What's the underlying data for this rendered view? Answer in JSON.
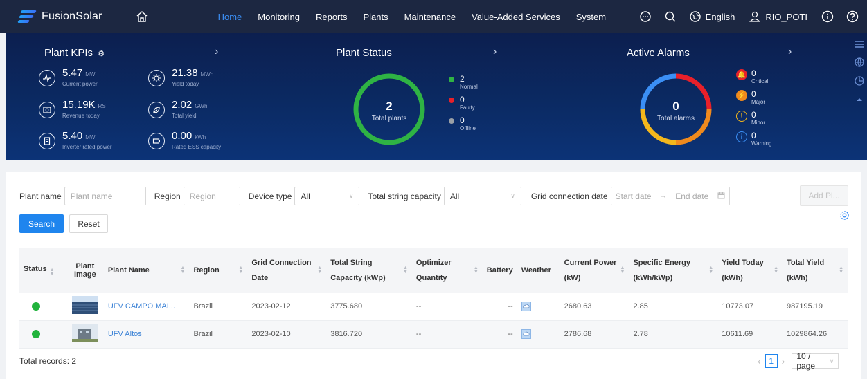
{
  "app": {
    "name": "FusionSolar"
  },
  "nav": {
    "menu": [
      {
        "label": "Home",
        "active": true
      },
      {
        "label": "Monitoring"
      },
      {
        "label": "Reports"
      },
      {
        "label": "Plants"
      },
      {
        "label": "Maintenance"
      },
      {
        "label": "Value-Added Services"
      },
      {
        "label": "System"
      }
    ],
    "language": "English",
    "user": "RIO_POTI"
  },
  "kpis": {
    "title": "Plant KPIs",
    "items": [
      {
        "value": "5.47",
        "unit": "MW",
        "label": "Current power",
        "icon": "power-icon"
      },
      {
        "value": "21.38",
        "unit": "MWh",
        "label": "Yield today",
        "icon": "gear-sun-icon"
      },
      {
        "value": "15.19K",
        "unit": "RS",
        "label": "Revenue today",
        "icon": "money-icon"
      },
      {
        "value": "2.02",
        "unit": "GWh",
        "label": "Total yield",
        "icon": "leaf-icon"
      },
      {
        "value": "5.40",
        "unit": "MW",
        "label": "Inverter rated power",
        "icon": "inverter-icon"
      },
      {
        "value": "0.00",
        "unit": "kWh",
        "label": "Rated ESS capacity",
        "icon": "battery-icon"
      }
    ]
  },
  "plant_status": {
    "title": "Plant Status",
    "total": "2",
    "total_label": "Total plants",
    "items": [
      {
        "value": "2",
        "label": "Normal",
        "color": "#2fb344"
      },
      {
        "value": "0",
        "label": "Faulty",
        "color": "#e8202a"
      },
      {
        "value": "0",
        "label": "Offline",
        "color": "#9aa0a6"
      }
    ]
  },
  "alarms": {
    "title": "Active Alarms",
    "total": "0",
    "total_label": "Total alarms",
    "items": [
      {
        "value": "0",
        "label": "Critical",
        "color": "#e8202a",
        "icon": "critical-alarm-icon"
      },
      {
        "value": "0",
        "label": "Major",
        "color": "#f08a1d",
        "icon": "major-alarm-icon"
      },
      {
        "value": "0",
        "label": "Minor",
        "color": "#f3b71c",
        "icon": "minor-alarm-icon"
      },
      {
        "value": "0",
        "label": "Warning",
        "color": "#3b8ff5",
        "icon": "warning-alarm-icon"
      }
    ]
  },
  "filters": {
    "plant_name_label": "Plant name",
    "plant_name_placeholder": "Plant name",
    "region_label": "Region",
    "region_placeholder": "Region",
    "device_type_label": "Device type",
    "device_type_value": "All",
    "string_capacity_label": "Total string capacity",
    "string_capacity_value": "All",
    "grid_date_label": "Grid connection date",
    "start_placeholder": "Start date",
    "arrow": "→",
    "end_placeholder": "End date",
    "search_label": "Search",
    "reset_label": "Reset",
    "add_label": "Add Pl..."
  },
  "table": {
    "headers": {
      "status": "Status",
      "image_1": "Plant",
      "image_2": "Image",
      "name": "Plant Name",
      "region": "Region",
      "grid_1": "Grid Connection",
      "grid_2": "Date",
      "cap_1": "Total String",
      "cap_2": "Capacity (kWp)",
      "opt_1": "Optimizer",
      "opt_2": "Quantity",
      "battery": "Battery",
      "weather": "Weather",
      "power_1": "Current Power",
      "power_2": "(kW)",
      "spec_1": "Specific Energy",
      "spec_2": "(kWh/kWp)",
      "ytoday_1": "Yield Today",
      "ytoday_2": "(kWh)",
      "ytotal_1": "Total Yield",
      "ytotal_2": "(kWh)"
    },
    "rows": [
      {
        "name": "UFV CAMPO MAI...",
        "region": "Brazil",
        "grid_date": "2023-02-12",
        "capacity": "3775.680",
        "optimizer": "--",
        "battery": "--",
        "current_power": "2680.63",
        "specific_energy": "2.85",
        "yield_today": "10773.07",
        "total_yield": "987195.19"
      },
      {
        "name": "UFV Altos",
        "region": "Brazil",
        "grid_date": "2023-02-10",
        "capacity": "3816.720",
        "optimizer": "--",
        "battery": "--",
        "current_power": "2786.68",
        "specific_energy": "2.78",
        "yield_today": "10611.69",
        "total_yield": "1029864.26"
      }
    ]
  },
  "footer": {
    "total_records": "Total records: 2",
    "current_page": "1",
    "page_size": "10 / page"
  }
}
